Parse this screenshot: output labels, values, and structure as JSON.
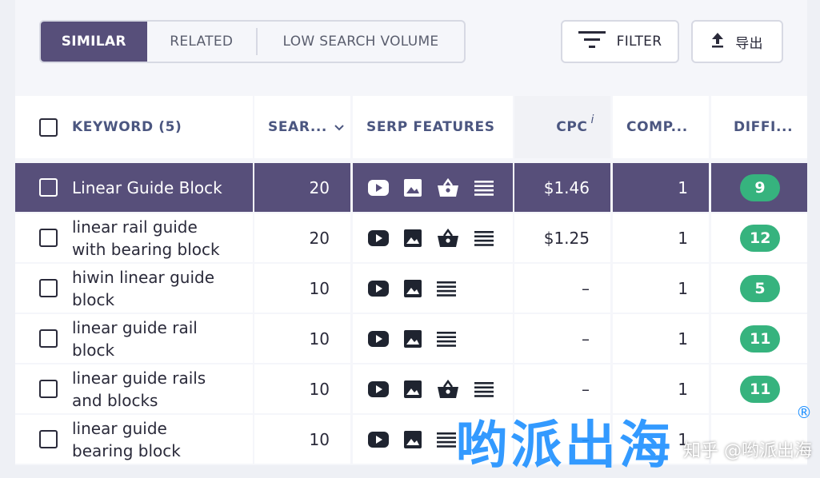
{
  "tabs": [
    {
      "label": "SIMILAR",
      "active": true
    },
    {
      "label": "RELATED",
      "active": false
    },
    {
      "label": "LOW SEARCH VOLUME",
      "active": false
    }
  ],
  "toolbar": {
    "filter_label": "FILTER",
    "export_label": "导出"
  },
  "columns": {
    "keyword": "KEYWORD",
    "keyword_count": "(5)",
    "search": "SEAR...",
    "serp": "SERP FEATURES",
    "cpc": "CPC",
    "cpc_info": "i",
    "comp": "COMP...",
    "diff": "DIFFI..."
  },
  "rows": [
    {
      "keyword": "Linear Guide Block",
      "search": "20",
      "features": [
        "video",
        "image",
        "shopping",
        "list"
      ],
      "cpc": "$1.46",
      "comp": "1",
      "diff": "9",
      "highlighted": true
    },
    {
      "keyword": "linear rail guide with bearing block",
      "search": "20",
      "features": [
        "video",
        "image",
        "shopping",
        "list"
      ],
      "cpc": "$1.25",
      "comp": "1",
      "diff": "12",
      "highlighted": false
    },
    {
      "keyword": "hiwin linear guide block",
      "search": "10",
      "features": [
        "video",
        "image",
        "list"
      ],
      "cpc": "–",
      "comp": "1",
      "diff": "5",
      "highlighted": false
    },
    {
      "keyword": "linear guide rail block",
      "search": "10",
      "features": [
        "video",
        "image",
        "list"
      ],
      "cpc": "–",
      "comp": "1",
      "diff": "11",
      "highlighted": false
    },
    {
      "keyword": "linear guide rails and blocks",
      "search": "10",
      "features": [
        "video",
        "image",
        "shopping",
        "list"
      ],
      "cpc": "–",
      "comp": "1",
      "diff": "11",
      "highlighted": false
    },
    {
      "keyword": "linear guide bearing block",
      "search": "10",
      "features": [
        "video",
        "image",
        "list"
      ],
      "cpc": "–",
      "comp": "1",
      "diff": "",
      "highlighted": false
    }
  ],
  "watermark": {
    "brand": "哟派出海",
    "handle": "知乎 @哟派出海",
    "reg": "®"
  },
  "colors": {
    "accent": "#574f7a",
    "difficulty_easy": "#36b37e",
    "header_text": "#4b5680"
  }
}
